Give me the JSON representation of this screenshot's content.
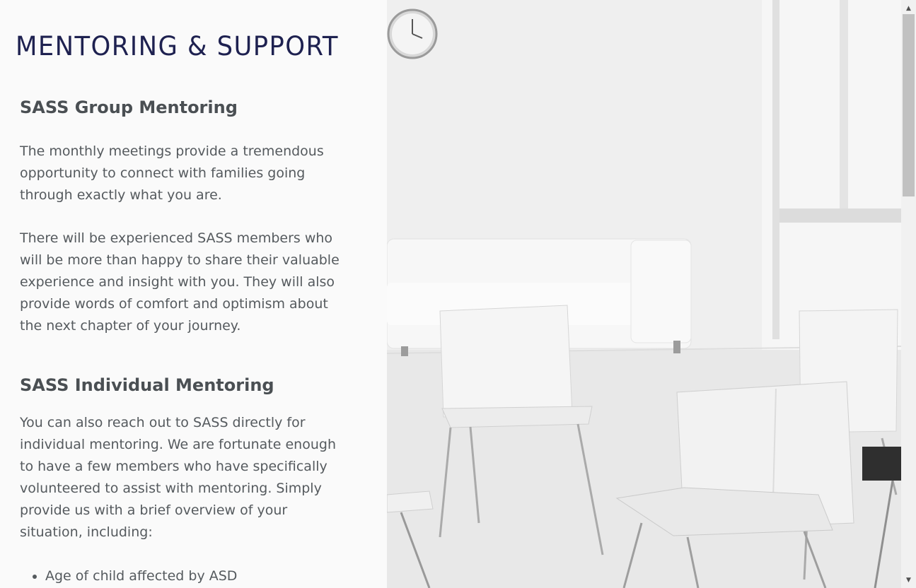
{
  "page": {
    "title": "MENTORING & SUPPORT"
  },
  "sections": {
    "group": {
      "heading": "SASS Group Mentoring",
      "paragraphs": [
        "The monthly meetings provide a tremendous opportunity to connect with families going through exactly what you are.",
        "There will be experienced SASS members who will be more than happy to share their valuable experience and insight with you. They will also provide words of comfort and optimism about the next chapter of your journey."
      ]
    },
    "individual": {
      "heading": "SASS Individual Mentoring",
      "paragraph": "You can also reach out to SASS directly for individual mentoring.  We are fortunate enough to have a few members who have specifically volunteered to assist with mentoring.  Simply provide us with a brief overview of your situation, including:",
      "bullets": [
        "Age of child affected by ASD"
      ]
    }
  },
  "scrollbar": {
    "up_glyph": "▲",
    "down_glyph": "▼"
  },
  "colors": {
    "title": "#1e2150",
    "heading": "#4a4f53",
    "body_text": "#555a5e",
    "left_background": "#fafafa"
  }
}
